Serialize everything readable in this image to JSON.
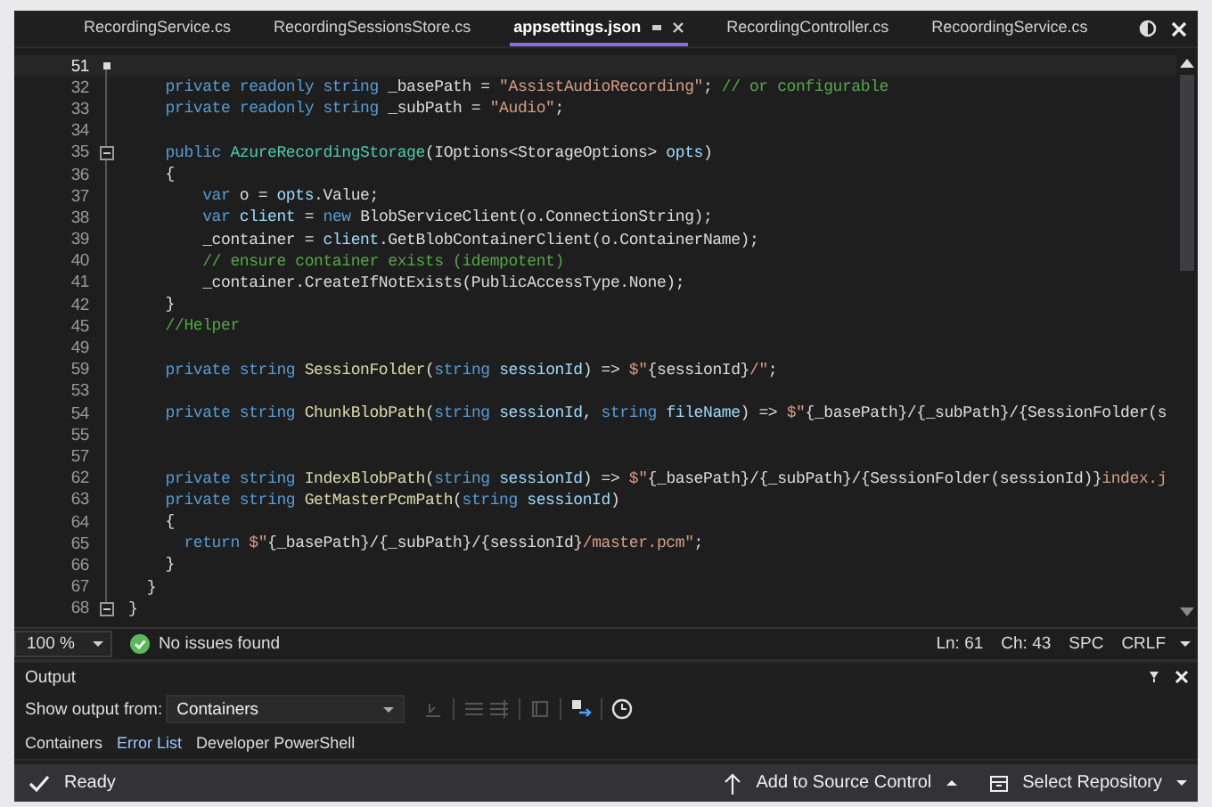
{
  "tabs": [
    {
      "label": "RecordingService.cs",
      "selected": false
    },
    {
      "label": "RecordingSessionsStore.cs",
      "selected": false
    },
    {
      "label": "appsettings.json",
      "selected": true
    },
    {
      "label": "RecordingController.cs",
      "selected": false
    },
    {
      "label": "RecoordingService.cs",
      "selected": false
    }
  ],
  "editor": {
    "lines": [
      {
        "number": "51",
        "current": true
      },
      {
        "number": "32",
        "current": false,
        "tokens": [
          {
            "text": "    private readonly string ",
            "color": "#569cd6"
          },
          {
            "text": "_basePath = ",
            "color": "#dcdcdc"
          },
          {
            "text": "\"AssistAudioRecording\"",
            "color": "#d69d85"
          },
          {
            "text": "; ",
            "color": "#dcdcdc"
          },
          {
            "text": "// or configurable",
            "color": "#57a64a"
          }
        ]
      },
      {
        "number": "33",
        "current": false,
        "tokens": [
          {
            "text": "    private readonly string ",
            "color": "#569cd6"
          },
          {
            "text": "_subPath = ",
            "color": "#dcdcdc"
          },
          {
            "text": "\"Audio\"",
            "color": "#d69d85"
          },
          {
            "text": ";",
            "color": "#dcdcdc"
          }
        ]
      },
      {
        "number": "34",
        "current": false
      },
      {
        "number": "35",
        "current": false,
        "fold": true,
        "tokens": [
          {
            "text": "    public ",
            "color": "#569cd6"
          },
          {
            "text": "AzureRecordingStorage",
            "color": "#4ec9b0"
          },
          {
            "text": "(IOptions<StorageOptions> ",
            "color": "#dcdcdc"
          },
          {
            "text": "opts",
            "color": "#9cdcfe"
          },
          {
            "text": ")",
            "color": "#dcdcdc"
          }
        ]
      },
      {
        "number": "36",
        "current": false,
        "tokens": [
          {
            "text": "    {",
            "color": "#dcdcdc"
          }
        ]
      },
      {
        "number": "37",
        "current": false,
        "tokens": [
          {
            "text": "        var ",
            "color": "#569cd6"
          },
          {
            "text": "o = ",
            "color": "#dcdcdc"
          },
          {
            "text": "opts",
            "color": "#9cdcfe"
          },
          {
            "text": ".Value;",
            "color": "#dcdcdc"
          }
        ]
      },
      {
        "number": "38",
        "current": false,
        "tokens": [
          {
            "text": "        var ",
            "color": "#569cd6"
          },
          {
            "text": "client",
            "color": "#9cdcfe"
          },
          {
            "text": " = ",
            "color": "#dcdcdc"
          },
          {
            "text": "new ",
            "color": "#569cd6"
          },
          {
            "text": "BlobServiceClient(o.ConnectionString);",
            "color": "#dcdcdc"
          }
        ]
      },
      {
        "number": "39",
        "current": false,
        "tokens": [
          {
            "text": "        _container = ",
            "color": "#dcdcdc"
          },
          {
            "text": "client",
            "color": "#9cdcfe"
          },
          {
            "text": ".GetBlobContainerClient(o.ContainerName);",
            "color": "#dcdcdc"
          }
        ]
      },
      {
        "number": "40",
        "current": false,
        "tokens": [
          {
            "text": "        // ensure container exists (idempotent)",
            "color": "#57a64a"
          }
        ]
      },
      {
        "number": "41",
        "current": false,
        "tokens": [
          {
            "text": "        _container.CreateIfNotExists(PublicAccessType.None);",
            "color": "#dcdcdc"
          }
        ]
      },
      {
        "number": "42",
        "current": false,
        "tokens": [
          {
            "text": "    }",
            "color": "#dcdcdc"
          }
        ]
      },
      {
        "number": "45",
        "current": false,
        "tokens": [
          {
            "text": "    //Helper",
            "color": "#57a64a"
          }
        ]
      },
      {
        "number": "49",
        "current": false
      },
      {
        "number": "59",
        "current": false,
        "tokens": [
          {
            "text": "    private string ",
            "color": "#569cd6"
          },
          {
            "text": "SessionFolder",
            "color": "#dcdcaa"
          },
          {
            "text": "(",
            "color": "#dcdcdc"
          },
          {
            "text": "string ",
            "color": "#569cd6"
          },
          {
            "text": "sessionId",
            "color": "#9cdcfe"
          },
          {
            "text": ") => ",
            "color": "#dcdcdc"
          },
          {
            "text": "$\"",
            "color": "#d69d85"
          },
          {
            "text": "{sessionId}",
            "color": "#dcdcdc"
          },
          {
            "text": "/\"",
            "color": "#d69d85"
          },
          {
            "text": ";",
            "color": "#dcdcdc"
          }
        ]
      },
      {
        "number": "53",
        "current": false
      },
      {
        "number": "54",
        "current": false,
        "tokens": [
          {
            "text": "    private string ",
            "color": "#569cd6"
          },
          {
            "text": "ChunkBlobPath",
            "color": "#dcdcaa"
          },
          {
            "text": "(",
            "color": "#dcdcdc"
          },
          {
            "text": "string ",
            "color": "#569cd6"
          },
          {
            "text": "sessionId",
            "color": "#9cdcfe"
          },
          {
            "text": ", ",
            "color": "#dcdcdc"
          },
          {
            "text": "string ",
            "color": "#569cd6"
          },
          {
            "text": "fileName",
            "color": "#9cdcfe"
          },
          {
            "text": ") => ",
            "color": "#dcdcdc"
          },
          {
            "text": "$\"",
            "color": "#d69d85"
          },
          {
            "text": "{_basePath}/{_subPath}/{SessionFolder(s",
            "color": "#dcdcdc"
          }
        ]
      },
      {
        "number": "55",
        "current": false
      },
      {
        "number": "57",
        "current": false
      },
      {
        "number": "62",
        "current": false,
        "tokens": [
          {
            "text": "    private string ",
            "color": "#569cd6"
          },
          {
            "text": "IndexBlobPath",
            "color": "#dcdcaa"
          },
          {
            "text": "(",
            "color": "#dcdcdc"
          },
          {
            "text": "string ",
            "color": "#569cd6"
          },
          {
            "text": "sessionId",
            "color": "#9cdcfe"
          },
          {
            "text": ") => ",
            "color": "#dcdcdc"
          },
          {
            "text": "$\"",
            "color": "#d69d85"
          },
          {
            "text": "{_basePath}/{_subPath}/{SessionFolder(sessionId)}",
            "color": "#dcdcdc"
          },
          {
            "text": "index.j",
            "color": "#d69d85"
          }
        ]
      },
      {
        "number": "63",
        "current": false,
        "tokens": [
          {
            "text": "    private string ",
            "color": "#569cd6"
          },
          {
            "text": "GetMasterPcmPath",
            "color": "#dcdcaa"
          },
          {
            "text": "(",
            "color": "#dcdcdc"
          },
          {
            "text": "string ",
            "color": "#569cd6"
          },
          {
            "text": "sessionId",
            "color": "#9cdcfe"
          },
          {
            "text": ")",
            "color": "#dcdcdc"
          }
        ]
      },
      {
        "number": "64",
        "current": false,
        "tokens": [
          {
            "text": "    {",
            "color": "#dcdcdc"
          }
        ]
      },
      {
        "number": "65",
        "current": false,
        "tokens": [
          {
            "text": "      return ",
            "color": "#569cd6"
          },
          {
            "text": "$\"",
            "color": "#d69d85"
          },
          {
            "text": "{_basePath}/{_subPath}/{sessionId}",
            "color": "#dcdcdc"
          },
          {
            "text": "/master.pcm\"",
            "color": "#d69d85"
          },
          {
            "text": ";",
            "color": "#dcdcdc"
          }
        ]
      },
      {
        "number": "66",
        "current": false,
        "tokens": [
          {
            "text": "    }",
            "color": "#dcdcdc"
          }
        ]
      },
      {
        "number": "67",
        "current": false,
        "tokens": [
          {
            "text": "  }",
            "color": "#dcdcdc"
          }
        ]
      },
      {
        "number": "68",
        "current": false,
        "fold": true,
        "tokens": [
          {
            "text": "}",
            "color": "#dcdcdc"
          }
        ]
      }
    ]
  },
  "editor_status": {
    "zoom": "100 %",
    "issues": "No issues found",
    "line": "Ln: 61",
    "column": "Ch: 43",
    "whitespace": "SPC",
    "line_ending": "CRLF"
  },
  "output": {
    "title": "Output",
    "show_from_label": "Show output from:",
    "source": "Containers",
    "tabs": [
      {
        "label": "Containers",
        "selected": false
      },
      {
        "label": "Error List",
        "selected": true
      },
      {
        "label": "Developer PowerShell",
        "selected": false
      }
    ]
  },
  "status_bar": {
    "state": "Ready",
    "source_control": "Add to Source Control",
    "repository": "Select Repository"
  }
}
